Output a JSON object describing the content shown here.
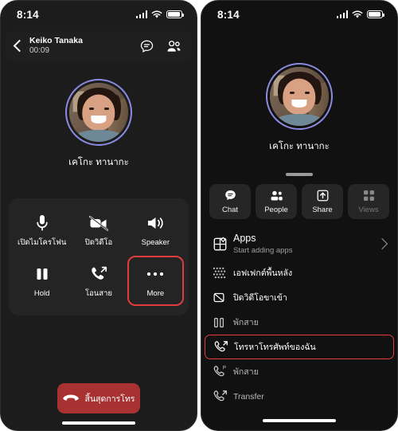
{
  "left_phone": {
    "status_bar": {
      "time": "8:14",
      "signal_icon": "signal-bars-icon",
      "wifi_icon": "wifi-icon",
      "battery_icon": "battery-icon"
    },
    "call_header": {
      "back_icon": "back-chevron-icon",
      "caller_name": "Keiko Tanaka",
      "call_duration": "00:09",
      "chat_icon": "chat-bubble-icon",
      "people_icon": "people-icon"
    },
    "participant": {
      "display_name": "เคโกะ ทานากะ",
      "avatar_ring_color": "#8a8ae0"
    },
    "controls": [
      {
        "label": "เปิดไมโครโฟน",
        "icon": "microphone-icon",
        "highlighted": false
      },
      {
        "label": "ปิดวิดีโอ",
        "icon": "video-off-icon",
        "highlighted": false
      },
      {
        "label": "Speaker",
        "icon": "speaker-icon",
        "highlighted": false
      },
      {
        "label": "Hold",
        "icon": "pause-icon",
        "highlighted": false
      },
      {
        "label": "โอนสาย",
        "icon": "call-transfer-icon",
        "highlighted": false
      },
      {
        "label": "More",
        "icon": "ellipsis-icon",
        "highlighted": true
      }
    ],
    "end_call": {
      "label": "สิ้นสุดการโทร",
      "icon": "hangup-phone-icon",
      "color": "#a83232"
    }
  },
  "right_phone": {
    "status_bar": {
      "time": "8:14",
      "signal_icon": "signal-bars-icon",
      "wifi_icon": "wifi-icon",
      "battery_icon": "battery-icon"
    },
    "participant": {
      "display_name": "เคโกะ ทานากะ",
      "avatar_ring_color": "#8a8ae0"
    },
    "drag_handle": "sheet-drag-handle",
    "tabs": [
      {
        "label": "Chat",
        "icon": "chat-bubble-icon",
        "disabled": false
      },
      {
        "label": "People",
        "icon": "people-icon",
        "disabled": false
      },
      {
        "label": "Share",
        "icon": "share-upload-icon",
        "disabled": false
      },
      {
        "label": "Views",
        "icon": "grid-views-icon",
        "disabled": true
      }
    ],
    "menu_items": [
      {
        "label": "Apps",
        "sublabel": "Start adding apps",
        "icon": "apps-icon",
        "chevron": true,
        "highlighted": false,
        "dim": false
      },
      {
        "label": "เอฟเฟกต์พื้นหลัง",
        "sublabel": "",
        "icon": "background-effects-icon",
        "chevron": false,
        "highlighted": false,
        "dim": false
      },
      {
        "label": "ปิดวิดีโอขาเข้า",
        "sublabel": "",
        "icon": "incoming-video-off-icon",
        "chevron": false,
        "highlighted": false,
        "dim": false
      },
      {
        "label": "พักสาย",
        "sublabel": "",
        "icon": "pause-icon",
        "chevron": false,
        "highlighted": false,
        "dim": true
      },
      {
        "label": "โทรหาโทรศัพท์ของฉัน",
        "sublabel": "",
        "icon": "call-out-icon",
        "chevron": false,
        "highlighted": true,
        "dim": false
      },
      {
        "label": "พักสาย",
        "sublabel": "",
        "icon": "call-park-icon",
        "chevron": false,
        "highlighted": false,
        "dim": true
      },
      {
        "label": "Transfer",
        "sublabel": "",
        "icon": "call-transfer-icon",
        "chevron": false,
        "highlighted": false,
        "dim": true
      }
    ]
  },
  "accents": {
    "highlight_red": "#e03c3c",
    "panel_bg": "#242424",
    "tab_bg": "#262626"
  }
}
